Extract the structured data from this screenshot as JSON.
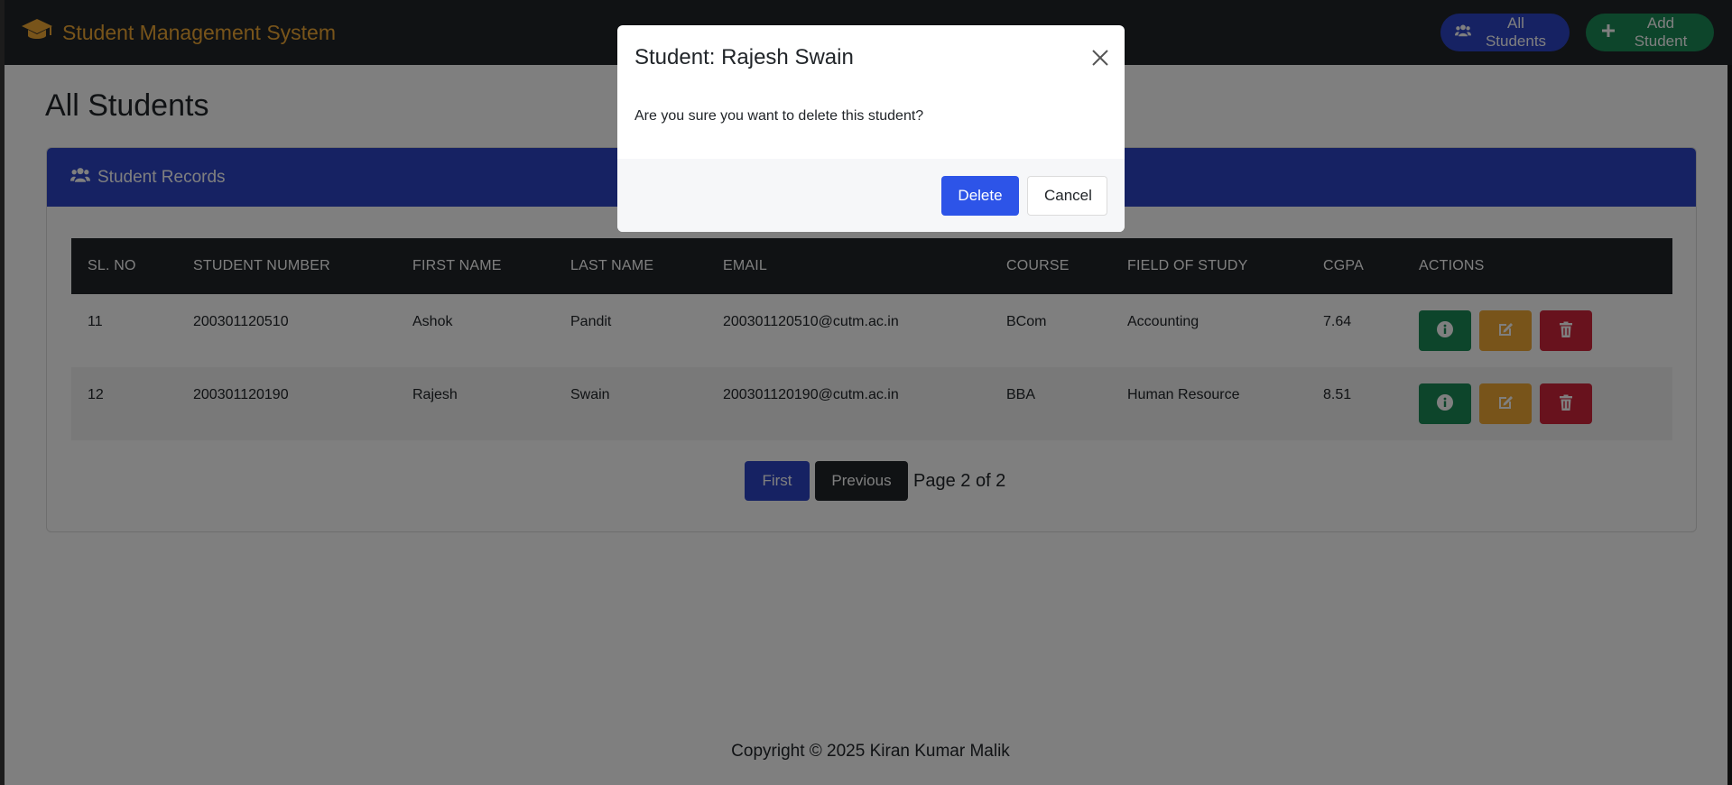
{
  "navbar": {
    "brand": "Student Management System",
    "brand_icon": "graduation-cap-icon",
    "all_students_label": "All Students",
    "add_student_label": "Add Student",
    "colors": {
      "bar": "#212529",
      "brand": "#f0a935",
      "blue": "#2d44c7",
      "green": "#1a8a57"
    }
  },
  "page": {
    "title": "All Students",
    "card_title": "Student Records"
  },
  "table": {
    "headers": [
      "SL. NO",
      "STUDENT NUMBER",
      "FIRST NAME",
      "LAST NAME",
      "EMAIL",
      "COURSE",
      "FIELD OF STUDY",
      "CGPA",
      "ACTIONS"
    ],
    "rows": [
      {
        "sl": "11",
        "number": "200301120510",
        "first": "Ashok",
        "last": "Pandit",
        "email": "200301120510@cutm.ac.in",
        "course": "BCom",
        "field": "Accounting",
        "cgpa": "7.64"
      },
      {
        "sl": "12",
        "number": "200301120190",
        "first": "Rajesh",
        "last": "Swain",
        "email": "200301120190@cutm.ac.in",
        "course": "BBA",
        "field": "Human Resource",
        "cgpa": "8.51"
      }
    ]
  },
  "pagination": {
    "first_label": "First",
    "previous_label": "Previous",
    "page_text": "Page 2 of 2"
  },
  "footer": {
    "text": "Copyright © 2025 Kiran Kumar Malik"
  },
  "modal": {
    "title": "Student: Rajesh Swain",
    "message": "Are you sure you want to delete this student?",
    "delete_label": "Delete",
    "cancel_label": "Cancel"
  }
}
